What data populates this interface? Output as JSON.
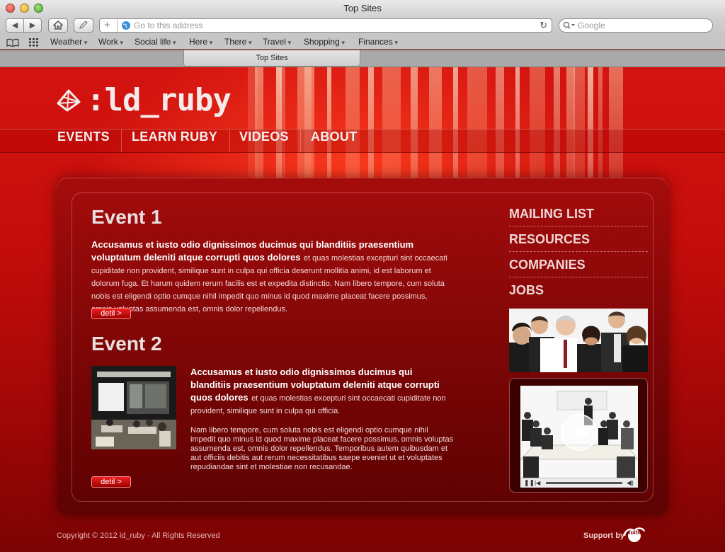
{
  "window": {
    "title": "Top Sites"
  },
  "toolbar": {
    "address_placeholder": "Go to this address",
    "search_placeholder": "Google"
  },
  "bookmarks": [
    "Weather",
    "Work",
    "Social life",
    "Here",
    "There",
    "Travel",
    "Shopping",
    "Finances"
  ],
  "tab": {
    "label": "Top Sites"
  },
  "site": {
    "logo": ":ld_ruby",
    "nav": [
      "EVENTS",
      "LEARN RUBY",
      "VIDEOS",
      "ABOUT"
    ],
    "events": [
      {
        "title": "Event 1",
        "lead": "Accusamus et iusto odio dignissimos ducimus qui blanditiis praesentium voluptatum deleniti atque corrupti quos dolores",
        "body": "et quas molestias excepturi sint occaecati cupiditate non provident, similique sunt in culpa qui officia deserunt mollitia animi, id est laborum et dolorum fuga. Et harum quidem rerum facilis est et expedita distinctio. Nam libero tempore, cum soluta nobis est eligendi optio cumque nihil impedit quo minus id quod maxime placeat facere possimus, omnis voluptas assumenda est, omnis dolor repellendus.",
        "button": "detil >"
      },
      {
        "title": "Event 2",
        "lead": "Accusamus et iusto odio dignissimos ducimus qui blanditiis praesentium voluptatum deleniti atque corrupti quos dolores",
        "body": "et quas molestias excepturi sint occaecati cupiditate non provident, similique sunt in culpa qui officia.",
        "body2": "Nam libero tempore, cum soluta nobis est eligendi optio cumque nihil impedit quo minus id quod maxime placeat facere possimus, omnis voluptas assumenda est, omnis dolor repellendus. Temporibus autem quibusdam et aut officiis debitis aut rerum necessitatibus saepe eveniet ut et voluptates repudiandae sint et molestiae non recusandae.",
        "button": "detil >"
      }
    ],
    "sidebar": [
      "MAILING LIST",
      "RESOURCES",
      "COMPANIES",
      "JOBS"
    ],
    "footer": {
      "copyright": "Copyright © 2012 id_ruby - All Rights Reserved",
      "support": "Support by",
      "support_logo": "suitmedia"
    }
  }
}
